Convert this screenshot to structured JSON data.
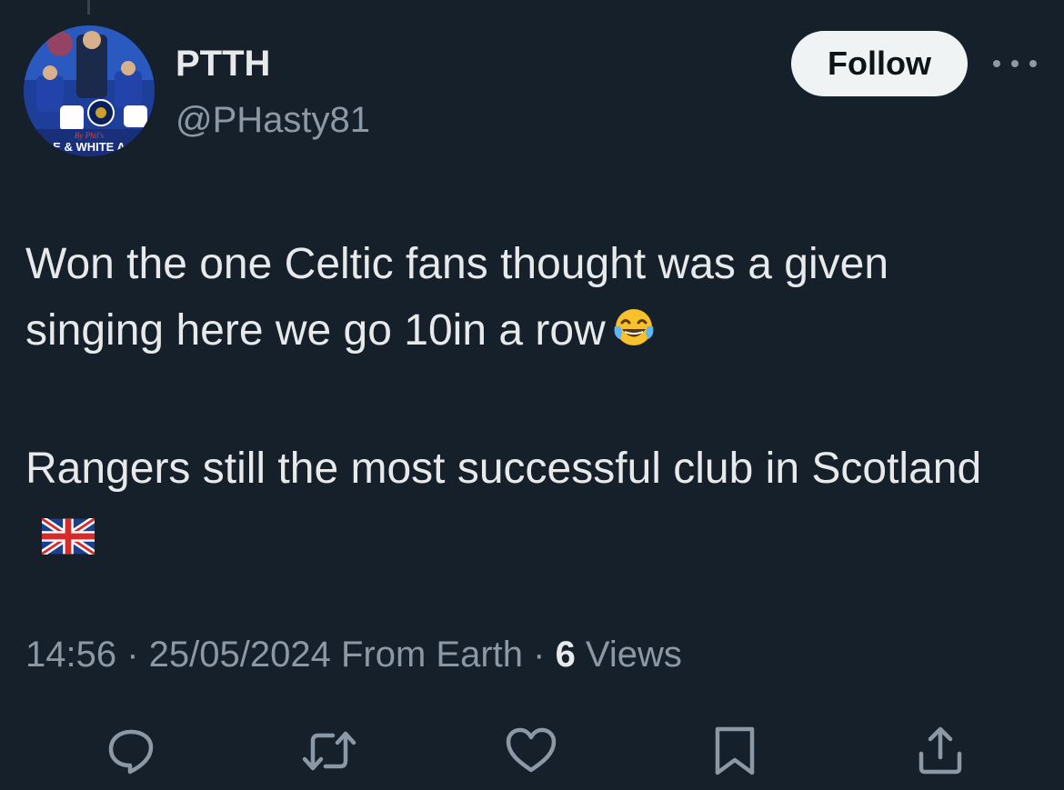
{
  "author": {
    "display_name": "PTTH",
    "handle": "@PHasty81",
    "avatar_caption": "E & WHITE A",
    "avatar_script": "By Phil's"
  },
  "follow_label": "Follow",
  "tweet": {
    "line1": "Won the one Celtic fans thought was a given singing here we go 10in a row",
    "line1_emoji": "face-with-tears-of-joy",
    "line2": "Rangers still the most successful club in Scotland",
    "line2_emoji": "union-jack-flag"
  },
  "meta": {
    "time": "14:56",
    "sep1": " · ",
    "date": "25/05/2024",
    "source": " From Earth",
    "sep2": " · ",
    "views_count": "6",
    "views_label": " Views"
  },
  "icons": {
    "reply": "reply-icon",
    "retweet": "retweet-icon",
    "like": "heart-icon",
    "bookmark": "bookmark-icon",
    "share": "share-icon",
    "more": "more-icon"
  },
  "colors": {
    "background": "#15202b",
    "primary_text": "#e7e9ea",
    "secondary_text": "#8b98a5",
    "follow_bg": "#eff3f4"
  }
}
